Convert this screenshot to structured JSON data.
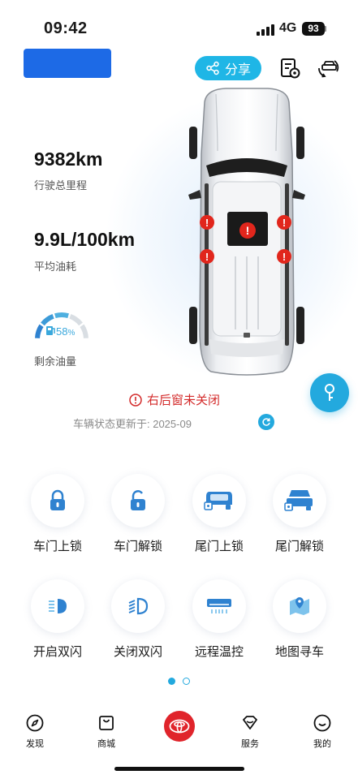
{
  "status_bar": {
    "time": "09:42",
    "network": "4G",
    "battery": "93"
  },
  "header": {
    "share_label": "分享"
  },
  "stats": {
    "mileage": {
      "value": "9382km",
      "label": "行驶总里程"
    },
    "fuel_consumption": {
      "value": "9.9L/100km",
      "label": "平均油耗"
    },
    "fuel_level": {
      "percent": "58",
      "unit": "%",
      "label": "剩余油量",
      "fraction": 0.58
    }
  },
  "vehicle_status": {
    "warning": "右后窗未关闭",
    "updated": "车辆状态更新于: 2025-09"
  },
  "controls": [
    {
      "label": "车门上锁"
    },
    {
      "label": "车门解锁"
    },
    {
      "label": "尾门上锁"
    },
    {
      "label": "尾门解锁"
    },
    {
      "label": "开启双闪"
    },
    {
      "label": "关闭双闪"
    },
    {
      "label": "远程温控"
    },
    {
      "label": "地图寻车"
    }
  ],
  "pagination": {
    "active_page": 1,
    "total_pages": 2
  },
  "nav": [
    {
      "label": "发现"
    },
    {
      "label": "商城"
    },
    {
      "label": "服务"
    },
    {
      "label": "我的"
    }
  ],
  "colors": {
    "accent": "#23a9de",
    "warning": "#d32a2a",
    "brand_red": "#e0242b",
    "badge_blue": "#1d6ae6"
  }
}
